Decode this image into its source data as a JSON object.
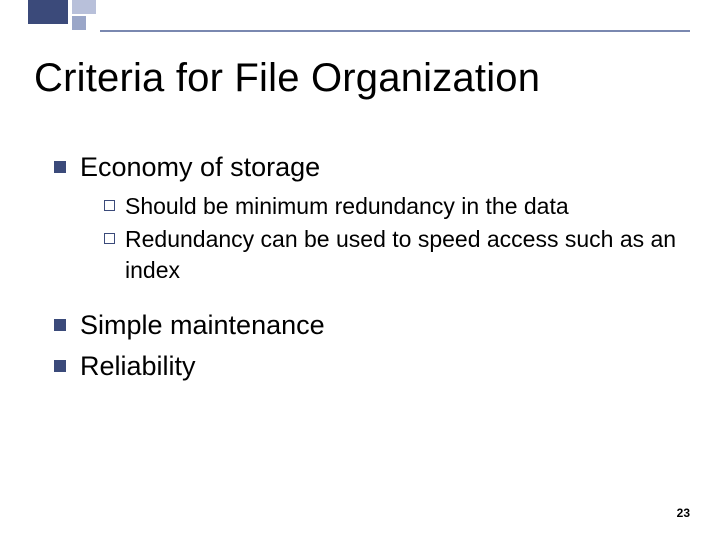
{
  "title": "Criteria for File Organization",
  "bullets": {
    "b1": "Economy of storage",
    "b1_sub1": "Should be minimum redundancy in the data",
    "b1_sub2": "Redundancy can be used to speed access such as an index",
    "b2": "Simple maintenance",
    "b3": "Reliability"
  },
  "page_number": "23"
}
